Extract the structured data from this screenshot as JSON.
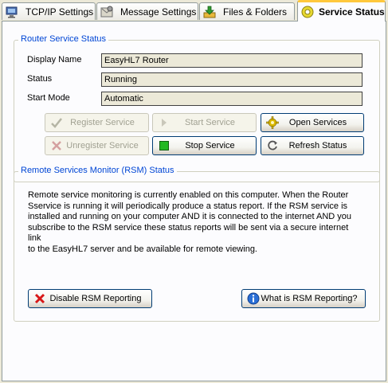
{
  "tabs": [
    {
      "label": "TCP/IP Settings",
      "icon": "network-computer-icon",
      "active": false
    },
    {
      "label": "Message Settings",
      "icon": "message-settings-icon",
      "active": false
    },
    {
      "label": "Files & Folders",
      "icon": "download-folder-icon",
      "active": false
    },
    {
      "label": "Service Status",
      "icon": "service-gear-icon",
      "active": true
    }
  ],
  "router_service": {
    "title": "Router Service Status",
    "fields": [
      {
        "label": "Display Name",
        "value": "EasyHL7 Router"
      },
      {
        "label": "Status",
        "value": "Running"
      },
      {
        "label": "Start Mode",
        "value": "Automatic"
      }
    ],
    "buttons": {
      "register": {
        "label": "Register Service",
        "enabled": false,
        "icon": "checkmark-pen-icon"
      },
      "start": {
        "label": "Start Service",
        "enabled": false,
        "icon": "play-arrow-icon"
      },
      "open_services": {
        "label": "Open Services",
        "enabled": true,
        "icon": "gear-icon"
      },
      "unregister": {
        "label": "Unregister Service",
        "enabled": false,
        "icon": "cross-pen-icon"
      },
      "stop": {
        "label": "Stop Service",
        "enabled": true,
        "icon": "stop-square-icon"
      },
      "refresh": {
        "label": "Refresh Status",
        "enabled": true,
        "icon": "refresh-icon"
      }
    }
  },
  "rsm": {
    "title": "Remote Services Monitor (RSM) Status",
    "description": "Remote service monitoring is currently enabled on this computer.  When the Router\nSservice is running it will periodically produce a status report.  If the RSM service is\ninstalled and running on your computer AND it is connected to the internet AND you\nsubscribe to the RSM service these status reports will be sent via a secure internet link\nto the EasyHL7 server and be available for remote viewing.",
    "buttons": {
      "disable": {
        "label": "Disable RSM Reporting",
        "icon": "red-x-icon"
      },
      "info": {
        "label": "What is RSM Reporting?",
        "icon": "info-icon"
      }
    }
  },
  "colors": {
    "group_title": "#0046d5",
    "active_tab_accent": "#ffc83c",
    "button_border": "#003c74",
    "stop_green": "#22b822"
  }
}
